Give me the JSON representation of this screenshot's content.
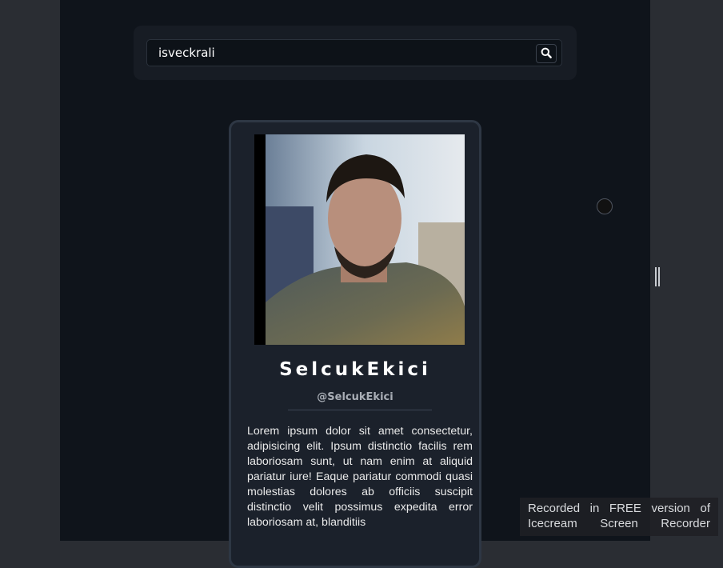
{
  "search": {
    "value": "isveckrali",
    "button_icon": "search-icon"
  },
  "profile": {
    "display_name": "SelcukEkici",
    "username": "@SelcukEkici",
    "bio": "Lorem ipsum dolor sit amet consectetur, adipisicing elit. Ipsum distinctio facilis rem laboriosam sunt, ut nam enim at aliquid pariatur iure! Eaque pariatur commodi quasi molestias dolores ab officiis suscipit distinctio velit possimus expedita error laboriosam at, blanditiis"
  },
  "watermark": {
    "line1": "Recorded in FREE version of",
    "line2": "Icecream Screen Recorder"
  },
  "colors": {
    "page_bg": "#0f141b",
    "card_bg": "#1b212b",
    "card_border": "#2e3744"
  }
}
